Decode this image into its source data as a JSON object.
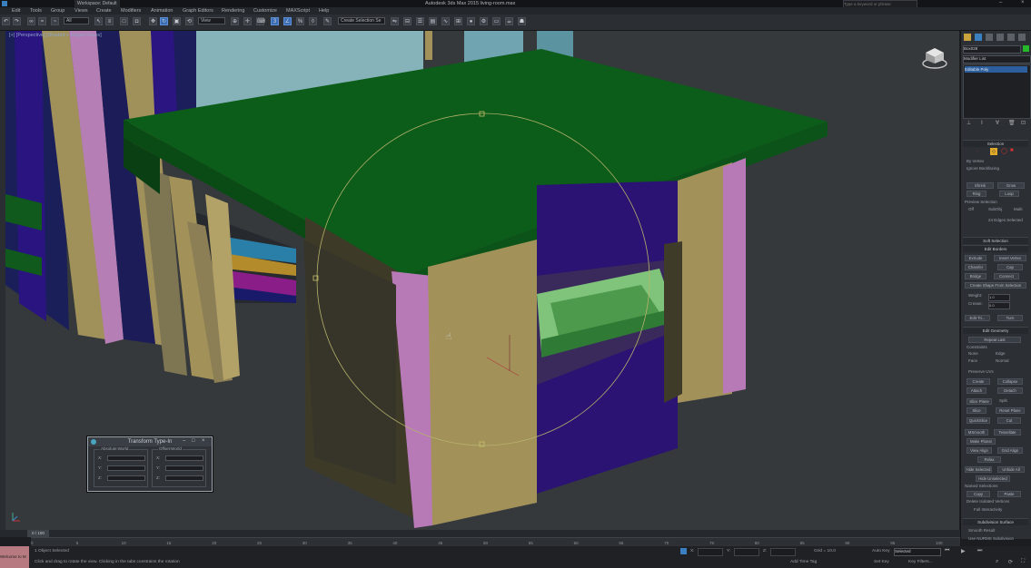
{
  "window": {
    "workspace": "Workspace: Default",
    "title": "Autodesk 3ds Max  2015    living-room.max",
    "search_placeholder": "Type a keyword or phrase"
  },
  "menu": [
    "Edit",
    "Tools",
    "Group",
    "Views",
    "Create",
    "Modifiers",
    "Animation",
    "Graph Editors",
    "Rendering",
    "Customize",
    "MAXScript",
    "Help"
  ],
  "toolbar": {
    "filter": "All",
    "ref_coord": "View",
    "selection_set": "Create Selection Se"
  },
  "viewport": {
    "label": "[+] [Perspective] [Shaded + Edged Faces]"
  },
  "command_panel": {
    "object_name": "Box028",
    "modifier_list": "Modifier List",
    "stack_item": "Editable Poly",
    "sections": {
      "selection": "Selection",
      "soft_selection": "Soft Selection",
      "edit_borders": "Edit Borders",
      "edit_geometry": "Edit Geometry",
      "subdivision_surface": "Subdivision Surface"
    },
    "labels": {
      "by_vertex": "By Vertex",
      "ignore_backfacing": "Ignore Backfacing",
      "shrink": "Shrink",
      "grow": "Grow",
      "ring": "Ring",
      "loop": "Loop",
      "preview_selection": "Preview Selection",
      "off": "Off",
      "subobj": "SubObj",
      "multi": "Multi",
      "edges_selected": "24 Edges Selected",
      "extrude": "Extrude",
      "insert_vertex": "Insert Vertex",
      "chamfer": "Chamfer",
      "cap": "Cap",
      "bridge": "Bridge",
      "connect": "Connect",
      "create_shape": "Create Shape From Selection",
      "weight": "Weight:",
      "crease": "Crease:",
      "edit_tri": "Edit Tri...",
      "turn": "Turn",
      "repeat_last": "Repeat Last",
      "constraints": "Constraints",
      "none": "None",
      "edge": "Edge",
      "face": "Face",
      "normal": "Normal",
      "preserve_uvs": "Preserve UVs",
      "create": "Create",
      "collapse": "Collapse",
      "attach": "Attach",
      "detach": "Detach",
      "slice_plane": "Slice Plane",
      "split": "Split",
      "slice": "Slice",
      "reset_plane": "Reset Plane",
      "quickslice": "QuickSlice",
      "cut": "Cut",
      "msmooth": "MSmooth",
      "tessellate": "Tessellate",
      "make_planar": "Make Planar",
      "view_align": "View Align",
      "grid_align": "Grid Align",
      "relax": "Relax",
      "hide_selected": "Hide Selected",
      "unhide_all": "Unhide All",
      "hide_unselected": "Hide Unselected",
      "named_selections": "Named Selections",
      "copy": "Copy",
      "paste": "Paste",
      "delete_isolated": "Delete Isolated Vertices",
      "full_interactivity": "Full Interactivity",
      "smooth_result": "Smooth Result",
      "use_nurms": "Use NURMS Subdivision"
    },
    "weight_value": "1.0",
    "crease_value": "0.0"
  },
  "dialog": {
    "title": "Transform Type-In",
    "absolute": "Absolute:World",
    "offset": "Offset:World",
    "axes": [
      "X:",
      "Y:",
      "Z:"
    ]
  },
  "timeline": {
    "frame": "0 / 100",
    "ticks": [
      "0",
      "5",
      "10",
      "15",
      "20",
      "25",
      "30",
      "35",
      "40",
      "45",
      "50",
      "55",
      "60",
      "65",
      "70",
      "75",
      "80",
      "85",
      "90",
      "95",
      "100"
    ]
  },
  "status": {
    "selected": "1 Object Selected",
    "prompt": "Click and drag to rotate the view.  Clicking in the tabs constrains the rotation",
    "grid": "Grid = 10.0",
    "auto_key": "Auto Key",
    "set_key": "Set Key",
    "selected_dropdown": "Selected",
    "key_filters": "Key Filters...",
    "add_time_tag": "Add Time Tag",
    "welcome": "Welcome to M",
    "x_label": "X:",
    "y_label": "Y:",
    "z_label": "Z:"
  },
  "colors": {
    "green": "#0d5f1c",
    "yellow": "#a2925a",
    "blue": "#2b1373",
    "pink": "#b878b8",
    "light_blue": "#86b8bf",
    "light_green": "#7fc47a"
  }
}
